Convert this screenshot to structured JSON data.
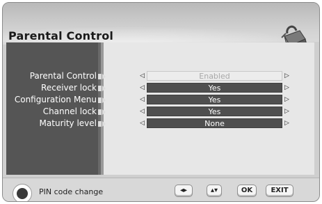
{
  "header": {
    "title": "Parental Control",
    "icon": "padlock-icon"
  },
  "menu": {
    "rows": [
      {
        "label": "Parental Control",
        "value": "Enabled",
        "state": "disabled"
      },
      {
        "label": "Receiver lock",
        "value": "Yes",
        "state": "active"
      },
      {
        "label": "Configuration Menu",
        "value": "Yes",
        "state": "active"
      },
      {
        "label": "Channel lock",
        "value": "Yes",
        "state": "active"
      },
      {
        "label": "Maturity level",
        "value": "None",
        "state": "active"
      }
    ],
    "arrow_left_glyph": "◁",
    "arrow_right_glyph": "▷"
  },
  "footer": {
    "pin_label": "PIN code change",
    "keys": {
      "left_right": "◂▸",
      "up_down": "▴▾",
      "ok": "OK",
      "exit": "EXIT"
    }
  },
  "colors": {
    "panel_dark": "#555555",
    "value_bg": "#4f4f4f",
    "disabled_bg": "#ececec"
  }
}
